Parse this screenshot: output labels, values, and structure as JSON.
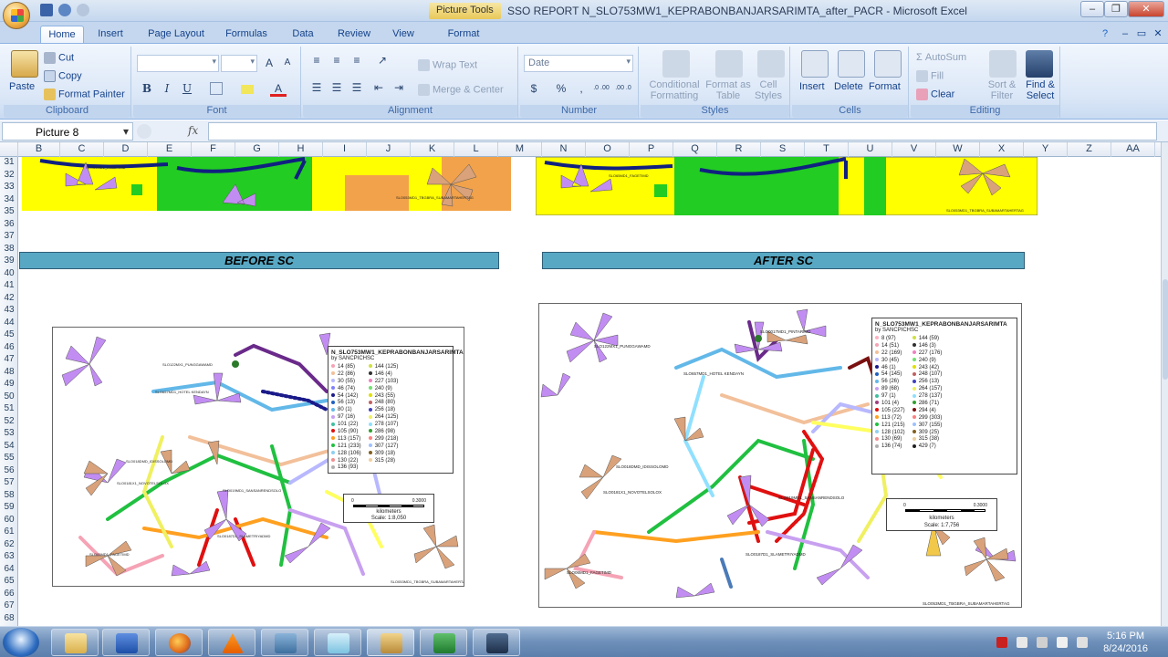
{
  "window": {
    "context_tab": "Picture Tools",
    "title": "SSO REPORT N_SLO753MW1_KEPRABONBANJARSARIMTA_after_PACR - Microsoft Excel"
  },
  "tabs": [
    "Home",
    "Insert",
    "Page Layout",
    "Formulas",
    "Data",
    "Review",
    "View",
    "Format"
  ],
  "ribbon": {
    "clipboard": {
      "paste": "Paste",
      "cut": "Cut",
      "copy": "Copy",
      "format_painter": "Format Painter",
      "label": "Clipboard"
    },
    "font": {
      "label": "Font",
      "bold": "B",
      "italic": "I",
      "underline": "U",
      "grow": "A",
      "shrink": "A"
    },
    "alignment": {
      "label": "Alignment",
      "wrap": "Wrap Text",
      "merge": "Merge & Center"
    },
    "number": {
      "label": "Number",
      "format": "Date",
      "currency": "$",
      "percent": "%",
      "comma": ",",
      "inc": ".0 .00",
      "dec": ".00 .0"
    },
    "styles": {
      "label": "Styles",
      "conditional": "Conditional Formatting",
      "table": "Format as Table",
      "cell": "Cell Styles"
    },
    "cells": {
      "label": "Cells",
      "insert": "Insert",
      "delete": "Delete",
      "format": "Format"
    },
    "editing": {
      "label": "Editing",
      "autosum": "AutoSum",
      "fill": "Fill",
      "clear": "Clear",
      "sort": "Sort & Filter",
      "find": "Find & Select"
    }
  },
  "formula_bar": {
    "name_box": "Picture 8",
    "fx": "fx"
  },
  "columns": [
    "B",
    "C",
    "D",
    "E",
    "F",
    "G",
    "H",
    "I",
    "J",
    "K",
    "L",
    "M",
    "N",
    "O",
    "P",
    "Q",
    "R",
    "S",
    "T",
    "U",
    "V",
    "W",
    "X",
    "Y",
    "Z",
    "AA"
  ],
  "rows": [
    "31",
    "32",
    "33",
    "34",
    "35",
    "36",
    "37",
    "38",
    "39",
    "40",
    "41",
    "42",
    "43",
    "44",
    "45",
    "46",
    "47",
    "48",
    "49",
    "50",
    "51",
    "52",
    "53",
    "54",
    "55",
    "56",
    "57",
    "58",
    "59",
    "60",
    "61",
    "62",
    "63",
    "64",
    "65",
    "66",
    "67",
    "68"
  ],
  "sheet": {
    "before_banner": "BEFORE SC",
    "after_banner": "AFTER SC"
  },
  "map_before": {
    "legend_title": "N_SLO753MW1_KEPRABONBANJARSARIMTA",
    "legend_subtitle": "by SANCPICHSC",
    "col1": [
      "14 (85)",
      "22 (86)",
      "30 (55)",
      "46 (74)",
      "54 (142)",
      "56 (13)",
      "80 (1)",
      "97 (16)",
      "101 (22)",
      "105 (90)",
      "113 (157)",
      "121 (233)",
      "128 (106)",
      "130 (22)",
      "136 (93)"
    ],
    "col2": [
      "144 (125)",
      "146 (4)",
      "227 (103)",
      "240 (9)",
      "243 (55)",
      "248 (80)",
      "256 (18)",
      "264 (125)",
      "278 (107)",
      "286 (98)",
      "299 (218)",
      "307 (127)",
      "309 (18)",
      "315 (28)"
    ],
    "colors1": [
      "#f5a3b5",
      "#f2c09a",
      "#b8b8ff",
      "#8080ff",
      "#1a1a8a",
      "#2060c0",
      "#62b8e8",
      "#c8a0f0",
      "#40c0a0",
      "#e01010",
      "#ffa020",
      "#20c040",
      "#8fd0f0",
      "#f09090",
      "#b0b0b0"
    ],
    "colors2": [
      "#d0e040",
      "#303030",
      "#f080c0",
      "#70e070",
      "#e0e000",
      "#c06060",
      "#4040c0",
      "#f0f060",
      "#90e0ff",
      "#30a030",
      "#ff8080",
      "#a0c0ff",
      "#806020",
      "#f0d0a0"
    ],
    "scale_label": "kilometers",
    "scale_zero": "0",
    "scale_max": "0.3000",
    "scale_ratio": "Scale: 1:8,050"
  },
  "map_after": {
    "legend_title": "N_SLO753MW1_KEPRABONBANJARSARIMTA",
    "legend_subtitle": "by SANCPICHSC",
    "col1": [
      "8 (97)",
      "14 (51)",
      "22 (169)",
      "30 (45)",
      "46 (1)",
      "54 (145)",
      "56 (26)",
      "89 (68)",
      "97 (1)",
      "101 (4)",
      "105 (227)",
      "113 (72)",
      "121 (215)",
      "128 (102)",
      "130 (69)",
      "136 (74)"
    ],
    "col2": [
      "144 (59)",
      "146 (3)",
      "227 (176)",
      "240 (9)",
      "243 (42)",
      "248 (107)",
      "256 (13)",
      "264 (157)",
      "278 (137)",
      "286 (71)",
      "294 (4)",
      "299 (303)",
      "307 (155)",
      "309 (25)",
      "315 (38)",
      "429 (7)"
    ],
    "colors1": [
      "#ffb0c0",
      "#f5a3b5",
      "#f2c09a",
      "#b8b8ff",
      "#1a1a8a",
      "#2060c0",
      "#62b8e8",
      "#c8a0f0",
      "#40c0a0",
      "#a04080",
      "#e01010",
      "#ffa020",
      "#20c040",
      "#8fd0f0",
      "#f09090",
      "#b0b0b0"
    ],
    "colors2": [
      "#d0e040",
      "#303030",
      "#f080c0",
      "#70e070",
      "#e0e000",
      "#c06060",
      "#4040c0",
      "#f0f060",
      "#90e0ff",
      "#30a030",
      "#7a1010",
      "#ff8080",
      "#a0c0ff",
      "#806020",
      "#f0d0a0",
      "#202020"
    ],
    "scale_label": "kilometers",
    "scale_zero": "0",
    "scale_max": "0.3000",
    "scale_ratio": "Scale: 1:7,756"
  },
  "taskbar": {
    "apps": [
      "explorer",
      "word",
      "firefox",
      "vlc",
      "mapinfo",
      "notepad",
      "excel-active",
      "excel",
      "app-s"
    ],
    "time": "5:16 PM",
    "date": "8/24/2016"
  }
}
